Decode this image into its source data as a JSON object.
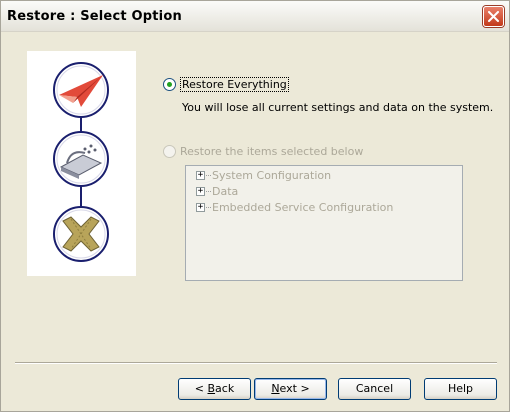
{
  "window": {
    "title": "Restore : Select Option"
  },
  "icons": {
    "close": "close-icon",
    "steps": [
      "paper-plane-icon",
      "restore-tape-icon",
      "tools-cross-icon"
    ]
  },
  "options": {
    "restore_everything": {
      "label": "Restore Everything",
      "selected": true,
      "description": "You will lose all current settings and data on the system."
    },
    "restore_selected": {
      "label": "Restore the items selected below",
      "selected": false,
      "enabled": false
    }
  },
  "tree": {
    "items": [
      {
        "label": "System Configuration",
        "expander": "+"
      },
      {
        "label": "Data",
        "expander": "+"
      },
      {
        "label": "Embedded Service Configuration",
        "expander": "+"
      }
    ]
  },
  "buttons": {
    "back": {
      "pre": "< ",
      "accel": "B",
      "post": "ack"
    },
    "next": {
      "pre": "",
      "accel": "N",
      "post": "ext >"
    },
    "cancel": {
      "label": "Cancel"
    },
    "help": {
      "label": "Help"
    }
  },
  "colors": {
    "titlebar_close": "#C2391A",
    "radio_checked": "#21A121",
    "disabled_text": "#ACA899",
    "button_border": "#003C74"
  }
}
